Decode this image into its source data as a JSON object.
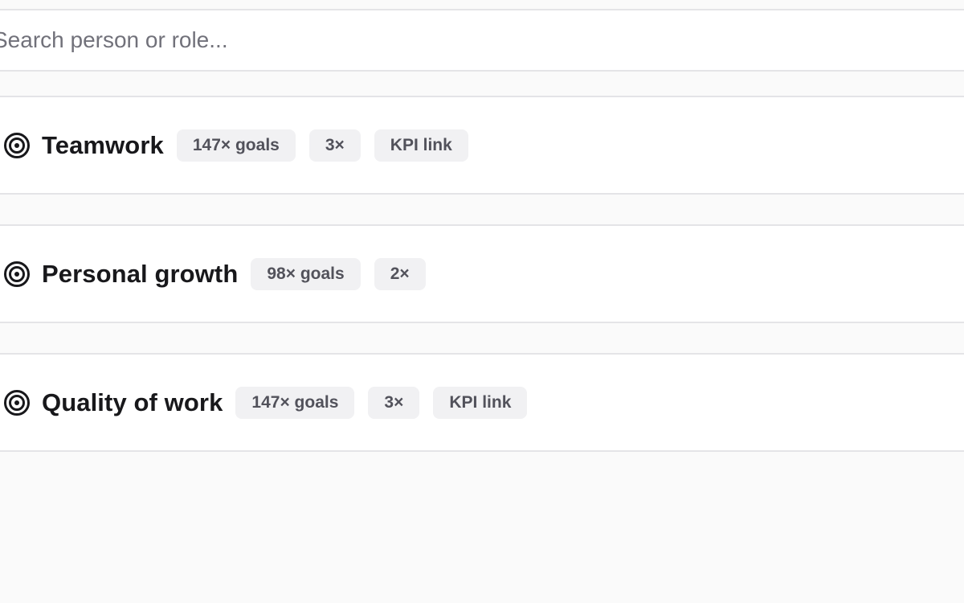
{
  "search": {
    "placeholder": "Search person or role..."
  },
  "cards": [
    {
      "title": "Teamwork",
      "icon": "target-icon",
      "chips": [
        "147× goals",
        "3×",
        "KPI link"
      ]
    },
    {
      "title": "Personal growth",
      "icon": "target-icon",
      "chips": [
        "98× goals",
        "2×"
      ]
    },
    {
      "title": "Quality of work",
      "icon": "target-icon",
      "chips": [
        "147× goals",
        "3×",
        "KPI link"
      ]
    }
  ],
  "colors": {
    "background": "#fafafa",
    "card": "#ffffff",
    "border": "#e4e4e7",
    "chip_bg": "#f1f1f3",
    "chip_text": "#52525b",
    "title_text": "#18181b"
  }
}
